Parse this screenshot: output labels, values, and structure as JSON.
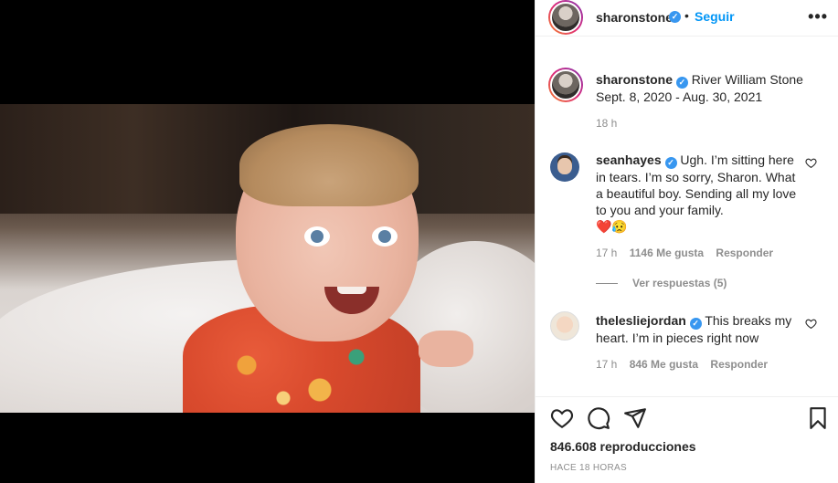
{
  "post": {
    "author": "sharonstone",
    "follow_label": "Seguir",
    "more_label": "•••",
    "separator": "•",
    "verified_mark": "✓"
  },
  "caption": {
    "author": "sharonstone",
    "line1": "River William Stone",
    "line2": "Sept. 8, 2020 - Aug. 30, 2021",
    "time": "18 h"
  },
  "comments": [
    {
      "author": "seanhayes",
      "text": "Ugh. I’m sitting here in tears. I’m so sorry, Sharon. What a beautiful boy. Sending all my love to you and your family.",
      "emoji": "❤️😥",
      "time": "17 h",
      "likes": "1146 Me gusta",
      "reply": "Responder",
      "view_replies": "Ver respuestas (5)"
    },
    {
      "author": "theleslie jordan",
      "author_display": "theleslie jordan",
      "text": "This breaks my heart. I’m in pieces right now",
      "time": "17 h",
      "likes": "846 Me gusta",
      "reply": "Responder"
    }
  ],
  "footer": {
    "views": "846.608 reproducciones",
    "posted": "Hace 18 horas"
  },
  "icons": [
    "heart-icon",
    "comment-icon",
    "share-icon",
    "save-icon",
    "verified-icon",
    "more-icon"
  ],
  "colors": {
    "link": "#0095f6",
    "verified": "#3897f0",
    "muted": "#8e8e8e",
    "text": "#262626"
  }
}
